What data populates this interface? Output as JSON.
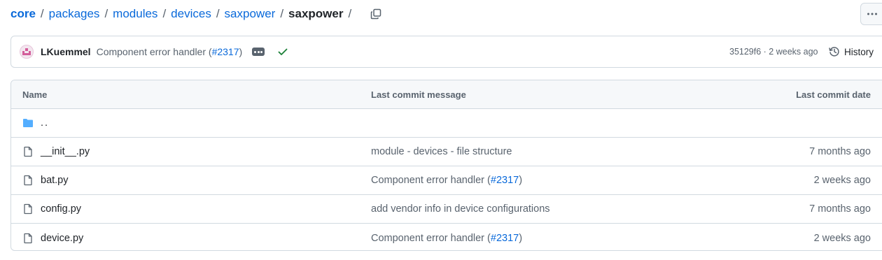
{
  "breadcrumb": {
    "segments": [
      {
        "label": "core"
      },
      {
        "label": "packages"
      },
      {
        "label": "modules"
      },
      {
        "label": "devices"
      },
      {
        "label": "saxpower"
      }
    ],
    "current": "saxpower",
    "separator": "/"
  },
  "latest_commit": {
    "author": "LKuemmel",
    "message_prefix": "Component error handler (",
    "pr_link": "#2317",
    "message_suffix": ")",
    "sha_and_time": "35129f6 · 2 weeks ago",
    "history_label": "History"
  },
  "table": {
    "headers": {
      "name": "Name",
      "message": "Last commit message",
      "date": "Last commit date"
    },
    "parent_dir": "..",
    "rows": [
      {
        "name": "__init__.py",
        "message": "module - devices - file structure",
        "pr": "",
        "date": "7 months ago"
      },
      {
        "name": "bat.py",
        "message": "Component error handler (",
        "pr": "#2317",
        "suffix": ")",
        "date": "2 weeks ago"
      },
      {
        "name": "config.py",
        "message": "add vendor info in device configurations",
        "pr": "",
        "date": "7 months ago"
      },
      {
        "name": "device.py",
        "message": "Component error handler (",
        "pr": "#2317",
        "suffix": ")",
        "date": "2 weeks ago"
      }
    ]
  },
  "icons": {
    "copy": "copy-icon",
    "more": "kebab-horizontal-icon",
    "check": "check-icon",
    "history": "history-clock-icon",
    "folder": "folder-icon",
    "file": "file-icon"
  },
  "colors": {
    "link": "#0969da",
    "muted": "#59636e",
    "border": "#d1d9e0",
    "folder": "#54aeff",
    "success": "#1a7f37"
  }
}
